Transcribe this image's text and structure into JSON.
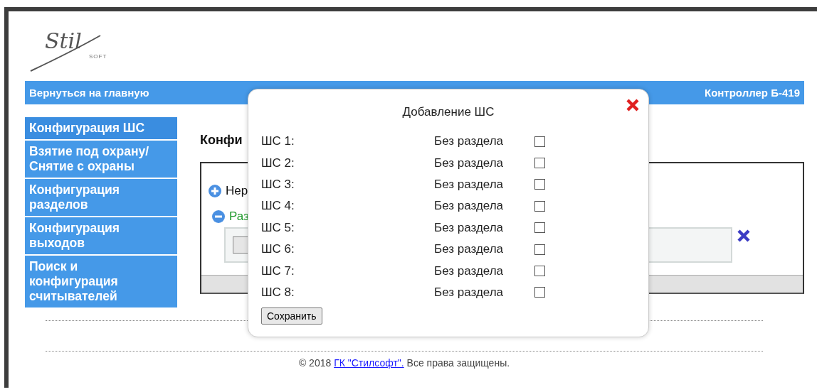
{
  "logo": {
    "script": "Stil",
    "sub": "SOFT"
  },
  "topbar": {
    "back_link": "Вернуться на главную",
    "device": "Контроллер Б-419"
  },
  "sidebar": {
    "items": [
      {
        "label": "Конфигурация ШС",
        "selected": true
      },
      {
        "label": "Взятие под охрану/ Снятие с охраны",
        "selected": false
      },
      {
        "label": "Конфигурация разделов",
        "selected": false
      },
      {
        "label": "Конфигурация выходов",
        "selected": false
      },
      {
        "label": "Поиск и конфигурация считывателей",
        "selected": false
      }
    ]
  },
  "content": {
    "heading": "Конфи",
    "groups": [
      {
        "label": "Нер",
        "expanded": false
      },
      {
        "label": "Раз",
        "expanded": true
      }
    ]
  },
  "dialog": {
    "title": "Добавление ШС",
    "rows": [
      {
        "label": "ШС 1:",
        "section": "Без раздела",
        "checked": false
      },
      {
        "label": "ШС 2:",
        "section": "Без раздела",
        "checked": false
      },
      {
        "label": "ШС 3:",
        "section": "Без раздела",
        "checked": false
      },
      {
        "label": "ШС 4:",
        "section": "Без раздела",
        "checked": false
      },
      {
        "label": "ШС 5:",
        "section": "Без раздела",
        "checked": false
      },
      {
        "label": "ШС 6:",
        "section": "Без раздела",
        "checked": false
      },
      {
        "label": "ШС 7:",
        "section": "Без раздела",
        "checked": false
      },
      {
        "label": "ШС 8:",
        "section": "Без раздела",
        "checked": false
      }
    ],
    "save_button": "Сохранить"
  },
  "footer": {
    "before": "© 2018 ",
    "link": "ГК \"Стилсофт\".",
    "after": " Все права защищены."
  }
}
